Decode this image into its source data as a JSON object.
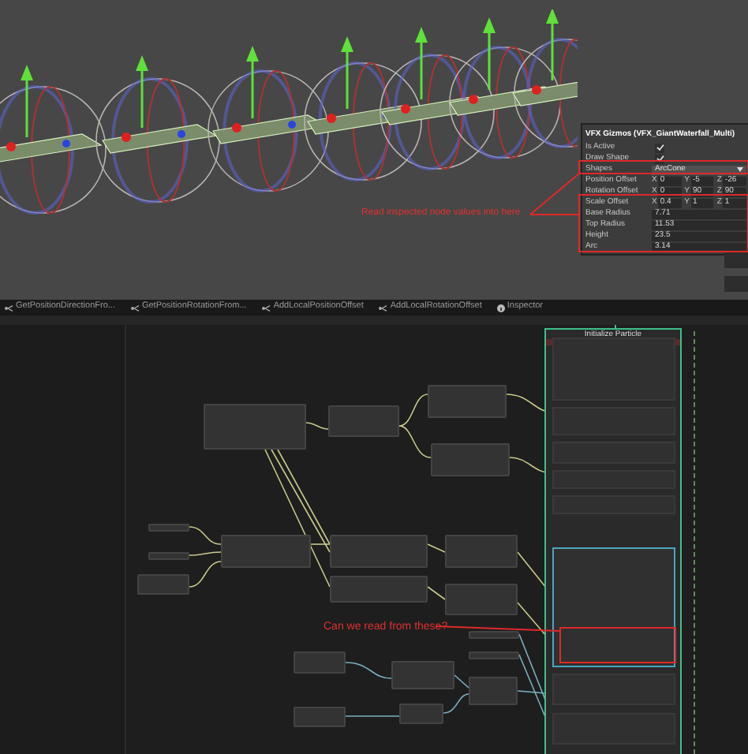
{
  "scene": {
    "annotation": "Read inspected node values into here"
  },
  "inspector": {
    "title": "VFX Gizmos (VFX_GiantWaterfall_Multi)",
    "rows": [
      {
        "kind": "toggle",
        "label": "Is Active",
        "checked": true
      },
      {
        "kind": "toggle",
        "label": "Draw Shape",
        "checked": true
      },
      {
        "kind": "dropdown",
        "label": "Shapes",
        "value": "ArcCone"
      },
      {
        "kind": "vector",
        "label": "Position Offset",
        "components": [
          {
            "axis": "X",
            "value": "0"
          },
          {
            "axis": "Y",
            "value": "-5"
          },
          {
            "axis": "Z",
            "value": "-26"
          }
        ]
      },
      {
        "kind": "vector",
        "label": "Rotation Offset",
        "components": [
          {
            "axis": "X",
            "value": "0"
          },
          {
            "axis": "Y",
            "value": "90"
          },
          {
            "axis": "Z",
            "value": "90"
          }
        ]
      },
      {
        "kind": "vector",
        "label": "Scale Offset",
        "components": [
          {
            "axis": "X",
            "value": "0.4"
          },
          {
            "axis": "Y",
            "value": "1"
          },
          {
            "axis": "Z",
            "value": "1"
          }
        ]
      },
      {
        "kind": "float",
        "label": "Base Radius",
        "value": "7.71"
      },
      {
        "kind": "float",
        "label": "Top Radius",
        "value": "11.53"
      },
      {
        "kind": "float",
        "label": "Height",
        "value": "23.5"
      },
      {
        "kind": "float",
        "label": "Arc",
        "value": "3.14"
      }
    ]
  },
  "tabs": [
    {
      "label": "GetPositionDirectionFro...",
      "kind": "graph",
      "selected": false
    },
    {
      "label": "GetPositionRotationFrom...",
      "kind": "graph",
      "selected": false
    },
    {
      "label": "AddLocalPositionOffset",
      "kind": "graph",
      "selected": false
    },
    {
      "label": "AddLocalRotationOffset",
      "kind": "graph",
      "selected": false
    },
    {
      "label": "Inspector",
      "kind": "inspector",
      "selected": false
    }
  ],
  "graph": {
    "context_title": "Initialize Particle",
    "annotation": "Can we read from these?"
  }
}
